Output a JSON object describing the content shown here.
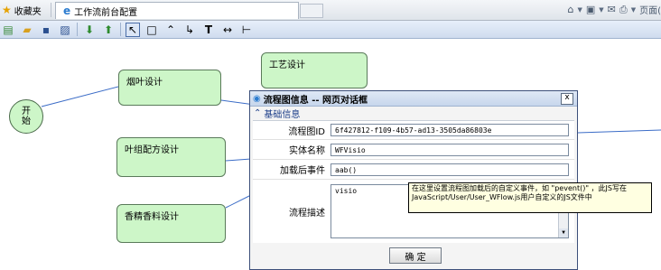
{
  "browser": {
    "favorites_label": "收藏夹",
    "tab_title": "工作流前台配置",
    "page_menu_label": "页面("
  },
  "toolbar": {
    "tools": [
      "new-icon",
      "open-icon",
      "save-icon",
      "save-as-icon",
      "down-arrow-icon",
      "up-arrow-icon",
      "pointer-icon",
      "rectangle-icon",
      "line-icon",
      "connector-icon",
      "text-icon",
      "resize-icon",
      "branch-icon"
    ],
    "text_tool_label": "T",
    "resize_tool_label": "↔",
    "branch_tool_label": "⊢"
  },
  "canvas": {
    "start_node": "开\n始",
    "nodes": {
      "yanye": "烟叶设计",
      "gongyi": "工艺设计",
      "yezu": "叶组配方设计",
      "xiangjing": "香精香料设计"
    }
  },
  "dialog": {
    "title": "流程图信息 -- 网页对话框",
    "close_label": "x",
    "section_title": "基础信息",
    "fields": {
      "id": {
        "label": "流程图ID",
        "value": "6f427812-f109-4b57-ad13-3505da86803e"
      },
      "entity": {
        "label": "实体名称",
        "value": "WFVisio"
      },
      "onload": {
        "label": "加载后事件",
        "value": "aab()"
      },
      "desc": {
        "label": "流程描述",
        "value": "visio"
      }
    },
    "ok_label": "确 定"
  },
  "tooltip": {
    "text": "在这里设置流程图加载后的自定义事件，如 \"pevent()\" ，此JS写在JavaScript/User/User_WFlow.js用户自定义的JS文件中"
  },
  "colors": {
    "node_fill": "#cdf6c8",
    "edge": "#3b6cc7",
    "tooltip_bg": "#ffffe1",
    "section_text": "#1a3c88"
  }
}
